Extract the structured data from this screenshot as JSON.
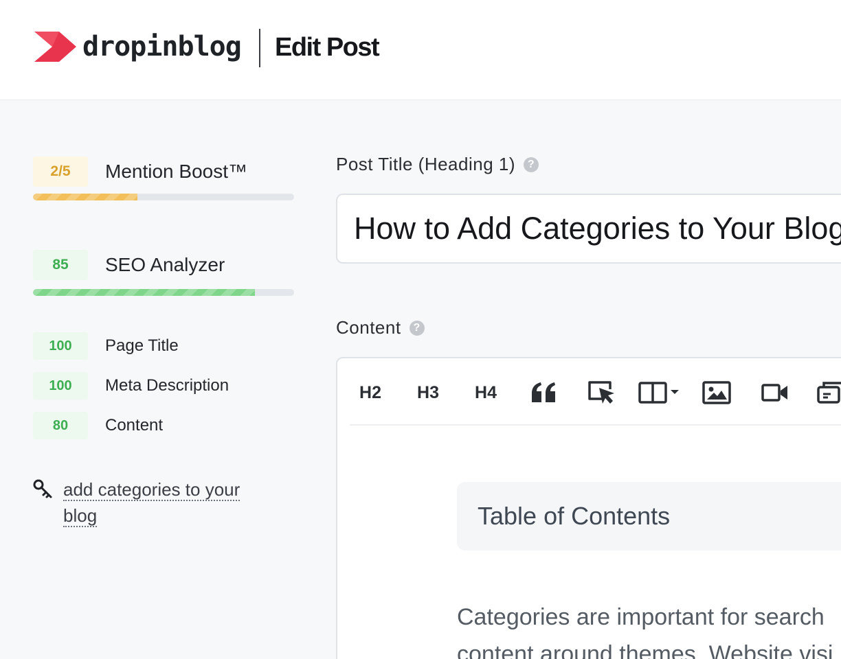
{
  "header": {
    "logo_text": "dropinblog",
    "page_title": "Edit Post",
    "brand_color": "#e8344d"
  },
  "sidebar": {
    "mention_boost": {
      "score": "2/5",
      "label": "Mention Boost™",
      "progress": 0.4
    },
    "seo_analyzer": {
      "score": "85",
      "label": "SEO Analyzer",
      "progress": 0.85
    },
    "checks": [
      {
        "score": "100",
        "label": "Page Title"
      },
      {
        "score": "100",
        "label": "Meta Description"
      },
      {
        "score": "80",
        "label": "Content"
      }
    ],
    "keyword": {
      "icon": "key-icon",
      "text": "add categories to your blog"
    }
  },
  "main": {
    "title_field": {
      "label": "Post Title (Heading 1)",
      "help": "?",
      "value": "How to Add Categories to Your Blog"
    },
    "content_field": {
      "label": "Content",
      "help": "?"
    },
    "toolbar": {
      "h2": "H2",
      "h3": "H3",
      "h4": "H4",
      "icons": [
        "quote-icon",
        "cursor-link-icon",
        "columns-dropdown-icon",
        "image-icon",
        "video-icon",
        "embed-icon"
      ]
    },
    "editor": {
      "toc_title": "Table of Contents",
      "line1": "Categories are important for search",
      "line2": "content around themes. Website visi"
    }
  }
}
